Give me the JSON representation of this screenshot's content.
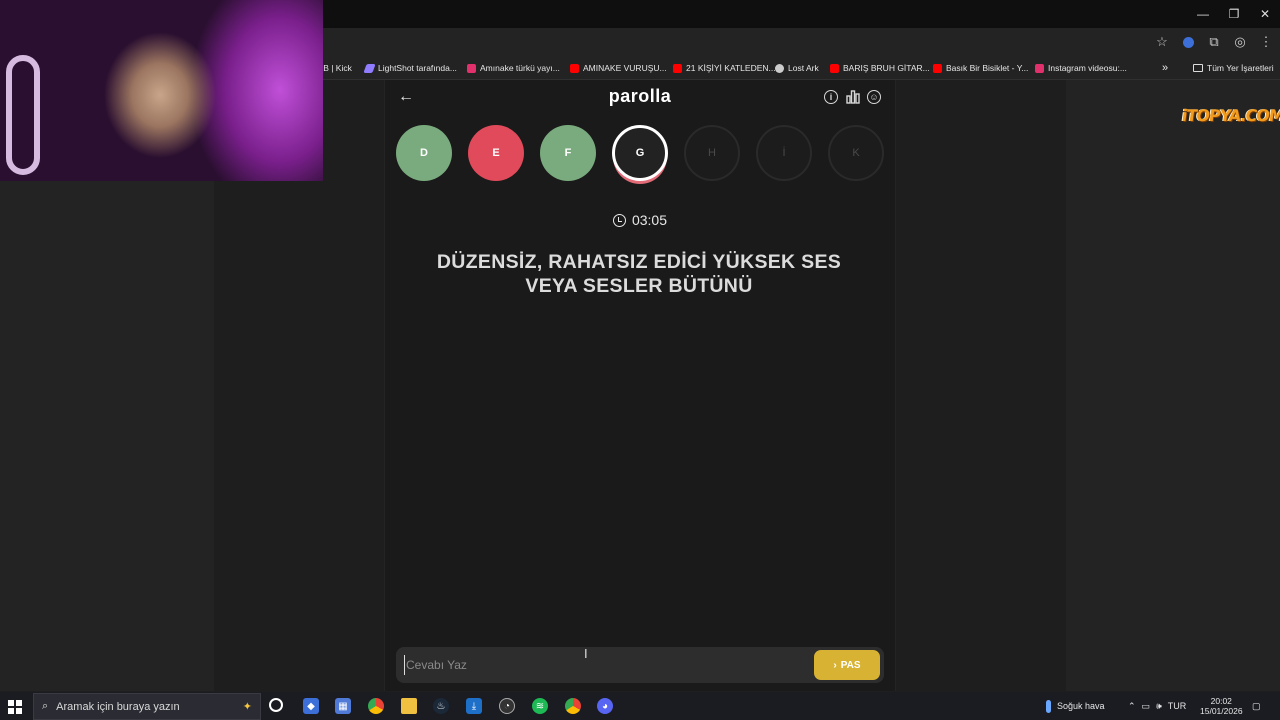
{
  "window_controls": [
    "—",
    "❐",
    "✕"
  ],
  "bookmarks": [
    {
      "label": "TB | Kick",
      "icon": "kick-icon",
      "color": ""
    },
    {
      "label": "LightShot tarafında...",
      "icon": "feather-icon",
      "color": "#8f7cff"
    },
    {
      "label": "Amınake türkü yayı...",
      "icon": "instagram-icon",
      "color": "#e1306c"
    },
    {
      "label": "AMINAKE VURUŞU...",
      "icon": "youtube-icon",
      "color": "#ff0000"
    },
    {
      "label": "21 KİŞİYİ KATLEDEN...",
      "icon": "youtube-icon",
      "color": "#ff0000"
    },
    {
      "label": "Lost Ark",
      "icon": "globe-icon",
      "color": "#cccccc"
    },
    {
      "label": "BARIŞ BRUH GİTAR...",
      "icon": "youtube-icon",
      "color": "#ff0000"
    },
    {
      "label": "Basık Bir Bisiklet - Y...",
      "icon": "youtube-icon",
      "color": "#ff0000"
    },
    {
      "label": "Instagram videosu:...",
      "icon": "instagram-icon",
      "color": "#e1306c"
    }
  ],
  "bookmarks_overflow": "»",
  "all_bookmarks": "Tüm Yer İşaretleri",
  "app": {
    "brand": "parolla",
    "back_icon": "arrow-left-icon",
    "info_icon": "info-icon",
    "stats_icon": "bar-chart-icon",
    "profile_icon": "user-circle-icon"
  },
  "letters": [
    {
      "char": "D",
      "state": "correct"
    },
    {
      "char": "E",
      "state": "wrong"
    },
    {
      "char": "F",
      "state": "correct"
    },
    {
      "char": "G",
      "state": "current"
    },
    {
      "char": "H",
      "state": "pending"
    },
    {
      "char": "İ",
      "state": "pending"
    },
    {
      "char": "K",
      "state": "pending"
    }
  ],
  "timer": "03:05",
  "question": "DÜZENSİZ, RAHATSIZ EDİCİ YÜKSEK SES VEYA SESLER BÜTÜNÜ",
  "answer": {
    "placeholder": "Cevabı Yaz",
    "value": "",
    "pass_label": "PAS",
    "pass_icon": "chevron-right-icon"
  },
  "watermark": "iTOPYA.COM",
  "taskbar": {
    "search_placeholder": "Aramak için buraya yazın",
    "weather": "Soğuk hava",
    "language": "TUR",
    "time": "20:02",
    "date": "15/01/2026"
  }
}
